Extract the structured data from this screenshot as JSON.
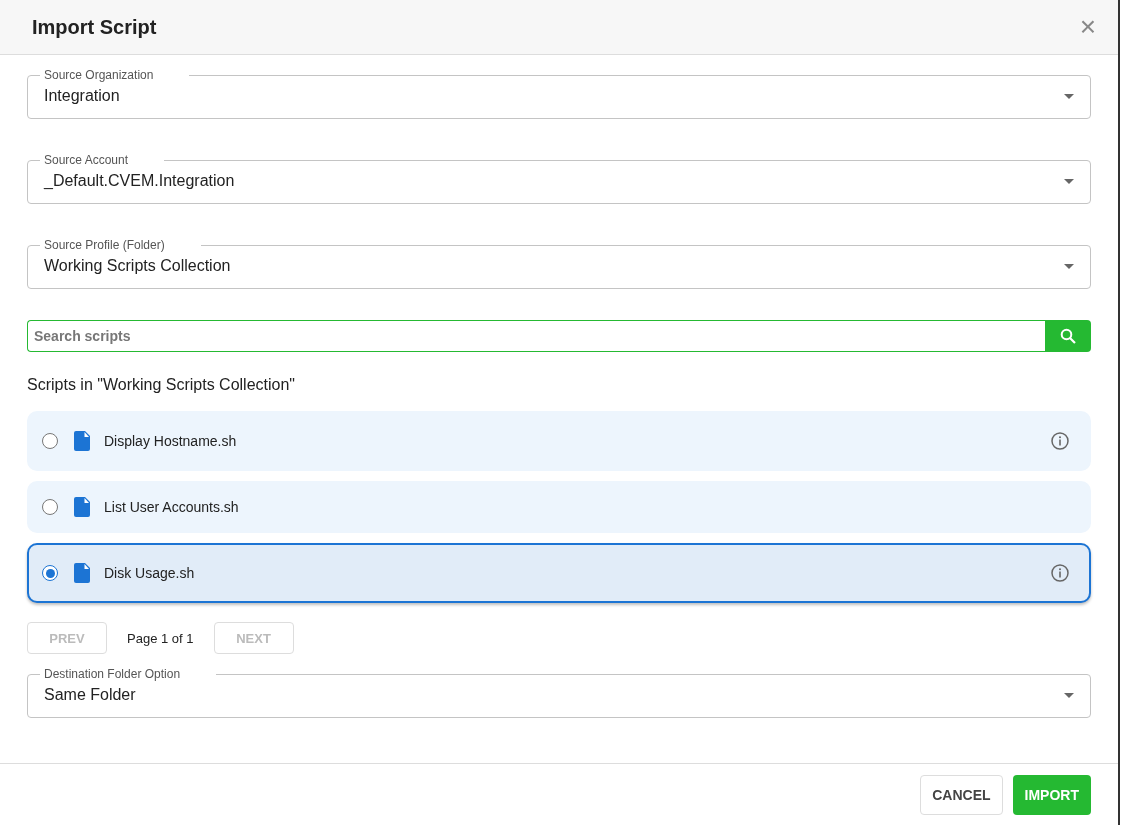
{
  "dialog": {
    "title": "Import Script",
    "close": "×"
  },
  "fields": [
    {
      "label": "Source Organization",
      "value": "Integration"
    },
    {
      "label": "Source Account",
      "value": "_Default.CVEM.Integration"
    },
    {
      "label": "Source Profile (Folder)",
      "value": "Working Scripts Collection"
    }
  ],
  "search": {
    "placeholder": "Search scripts"
  },
  "list_heading": "Scripts in \"Working Scripts Collection\"",
  "scripts": [
    {
      "name": "Display Hostname.sh",
      "selected": false,
      "info": true
    },
    {
      "name": "List User Accounts.sh",
      "selected": false,
      "info": false
    },
    {
      "name": "Disk Usage.sh",
      "selected": true,
      "info": true
    }
  ],
  "pagination": {
    "prev": {
      "label": "PREV",
      "disabled": true
    },
    "page": "Page 1 of 1",
    "next": {
      "label": "NEXT",
      "disabled": true
    }
  },
  "destination": {
    "label": "Destination Folder Option",
    "value": "Same Folder"
  },
  "buttons": [
    {
      "label": "CANCEL",
      "kind": "outlined"
    },
    {
      "label": "IMPORT",
      "kind": "primary"
    }
  ]
}
